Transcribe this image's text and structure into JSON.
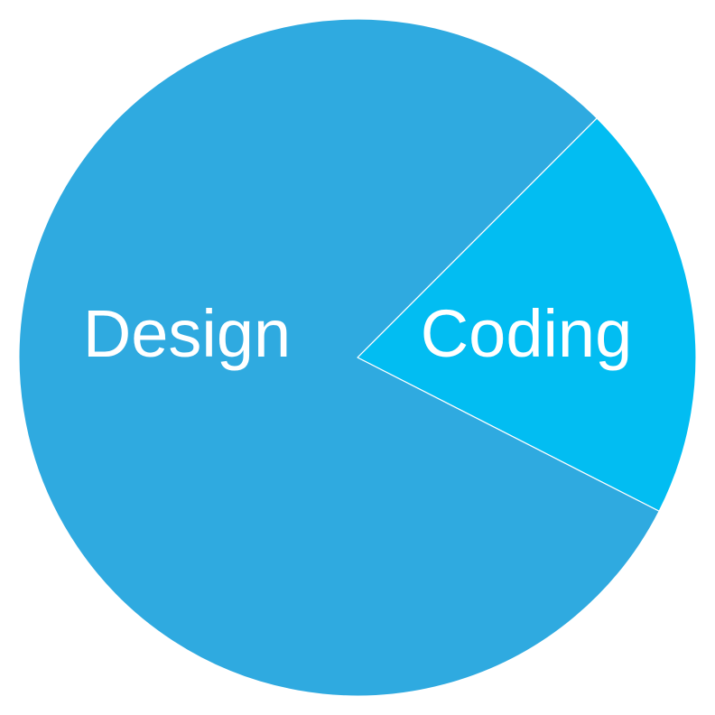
{
  "chart_data": {
    "type": "pie",
    "labels": [
      "Design",
      "Coding"
    ],
    "values": [
      80,
      20
    ],
    "colors": [
      "#2faae0",
      "#02bdf2"
    ],
    "separator_color": "#ffffff",
    "title": "",
    "legend": "none"
  }
}
